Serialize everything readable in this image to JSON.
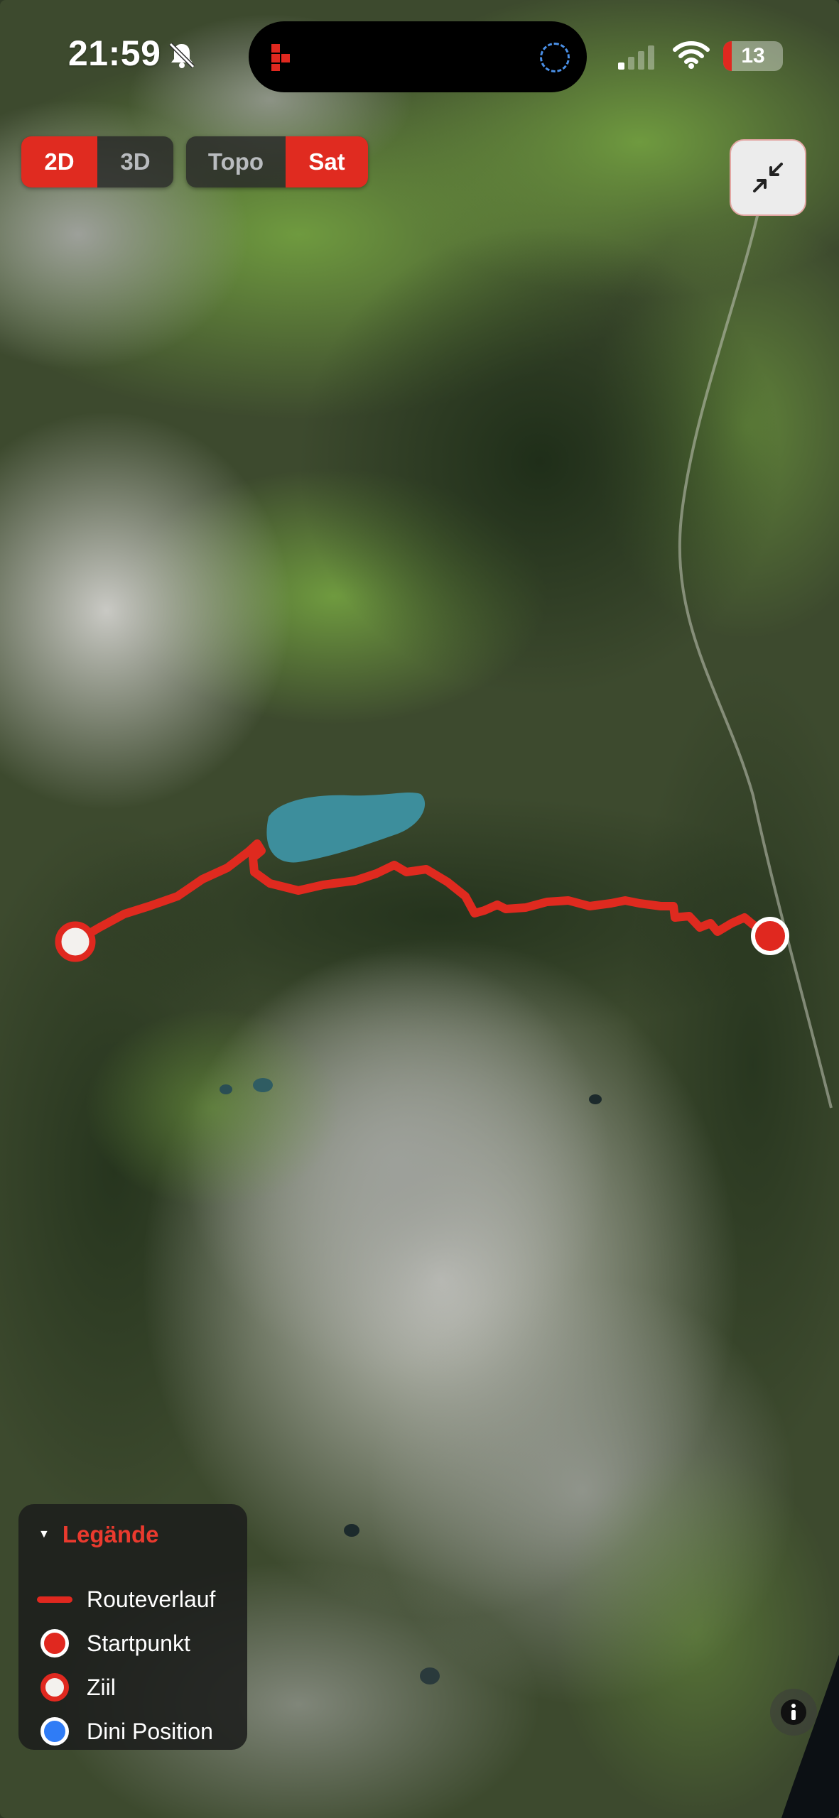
{
  "status_bar": {
    "time": "21:59",
    "battery_level": "13",
    "notifications": "silenced",
    "icons": [
      "bell-slash-icon",
      "cellular-signal-icon",
      "wifi-icon",
      "battery-icon"
    ]
  },
  "map_controls": {
    "dimension_toggle": {
      "options": [
        "2D",
        "3D"
      ],
      "selected": "2D"
    },
    "map_style_toggle": {
      "options": [
        "Topo",
        "Sat"
      ],
      "selected": "Sat"
    },
    "collapse_icon": "collapse-arrows-icon"
  },
  "legend": {
    "title": "Legände",
    "expanded": true,
    "items": [
      {
        "label": "Routeverlauf",
        "icon": "route-line"
      },
      {
        "label": "Startpunkt",
        "icon": "start-marker"
      },
      {
        "label": "Ziil",
        "icon": "goal-marker"
      },
      {
        "label": "Dini Position",
        "icon": "position-marker"
      }
    ]
  },
  "info_icon": "info-icon",
  "colors": {
    "accent": "#e02b20",
    "route": "#e0281f",
    "lake": "#3d8e9c",
    "position": "#2f7cf6",
    "control_bg": "#282828"
  }
}
